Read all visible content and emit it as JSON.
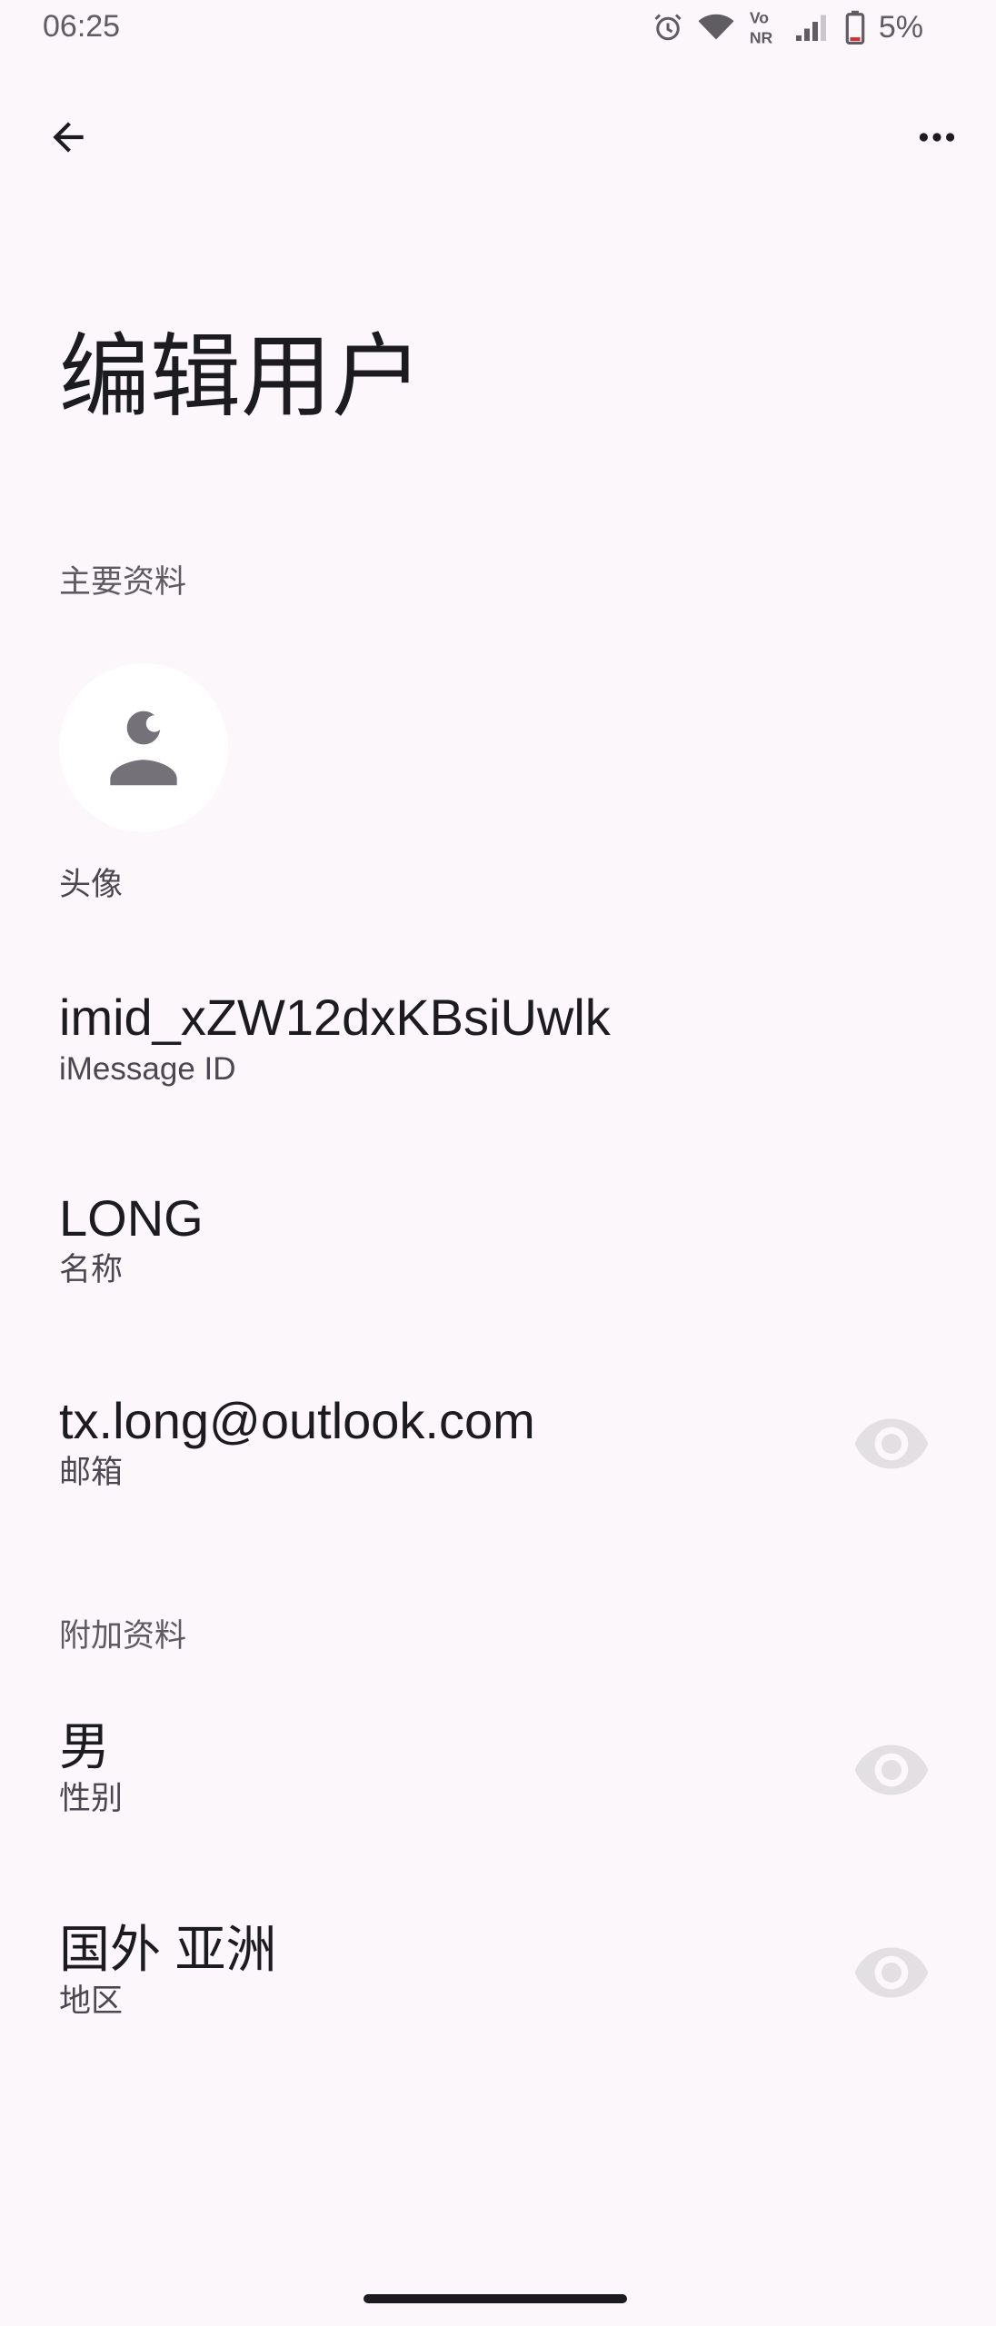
{
  "status_bar": {
    "time": "06:25",
    "battery": "5%",
    "icons": [
      "alarm-icon",
      "wifi-icon",
      "volte-nr-icon",
      "signal-icon",
      "battery-icon"
    ]
  },
  "app_bar": {
    "back_icon": "arrow-back-icon",
    "more_icon": "more-horizontal-icon"
  },
  "page": {
    "title": "编辑用户"
  },
  "primary_section": {
    "label": "主要资料",
    "avatar_label": "头像",
    "fields": [
      {
        "value": "imid_xZW12dxKBsiUwlk",
        "label": "iMessage ID"
      },
      {
        "value": "LONG",
        "label": "名称"
      },
      {
        "value": "tx.long@outlook.com",
        "label": "邮箱"
      }
    ]
  },
  "extra_section": {
    "label": "附加资料",
    "fields": [
      {
        "value": "男",
        "label": "性别"
      },
      {
        "value": "国外 亚洲",
        "label": "地区"
      }
    ]
  },
  "colors": {
    "background": "#fcf7fb",
    "text_primary": "#1c1b1f",
    "text_secondary": "#5d5a61",
    "eye_icon": "#e3e0e4",
    "avatar_icon": "#747178"
  }
}
